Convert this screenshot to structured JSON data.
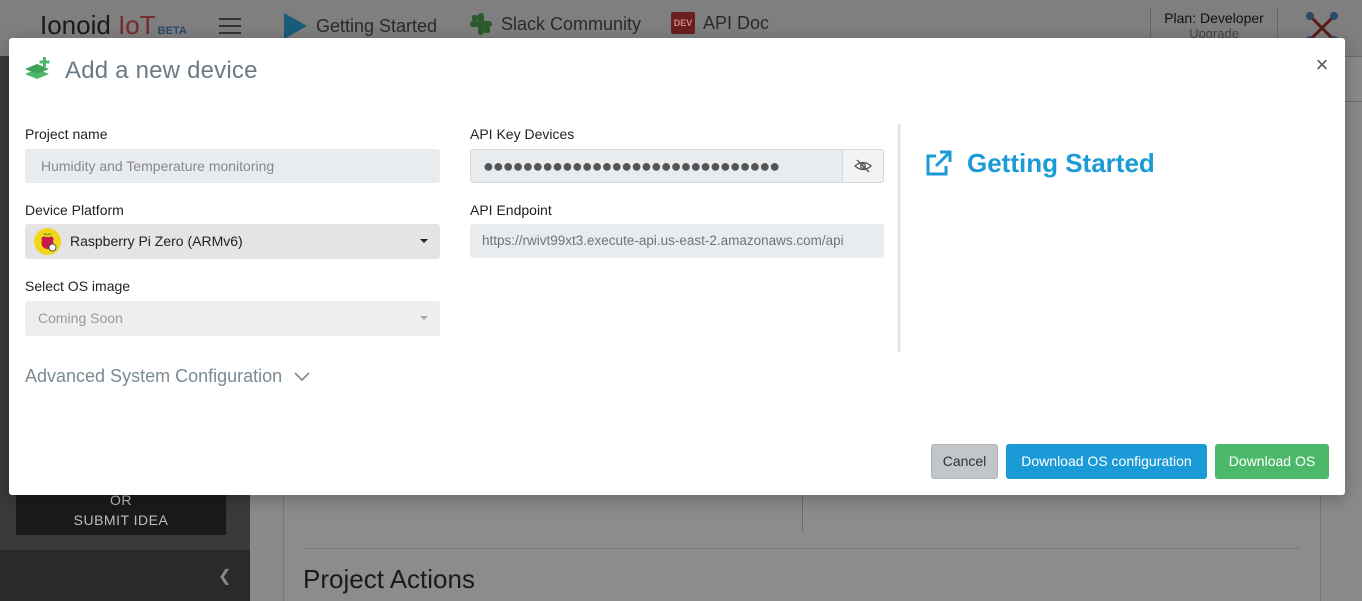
{
  "background": {
    "logo": {
      "main": "Ionoid",
      "iot": "IoT",
      "beta": "BETA"
    },
    "nav": [
      {
        "label": "Getting Started",
        "icon": "play-icon"
      },
      {
        "label": "Slack Community",
        "icon": "slack-icon"
      },
      {
        "label": "API Doc",
        "icon": "dev-icon",
        "badge": "DEV"
      }
    ],
    "plan": {
      "label": "Plan: Developer",
      "sub": "Upgrade"
    },
    "sidebar": {
      "idea_line1": "OR",
      "idea_line2": "SUBMIT IDEA"
    },
    "main": {
      "section_heading": "Project Actions"
    }
  },
  "modal": {
    "title": "Add a new device",
    "close": "×",
    "project_name": {
      "label": "Project name",
      "value": "Humidity and Temperature monitoring"
    },
    "device_platform": {
      "label": "Device Platform",
      "value": "Raspberry Pi Zero (ARMv6)"
    },
    "os_image": {
      "label": "Select OS image",
      "value": "Coming Soon"
    },
    "api_key": {
      "label": "API Key Devices",
      "value": "●●●●●●●●●●●●●●●●●●●●●●●●●●●●●●"
    },
    "api_endpoint": {
      "label": "API Endpoint",
      "value": "https://rwivt99xt3.execute-api.us-east-2.amazonaws.com/api"
    },
    "getting_started": "Getting Started",
    "advanced": "Advanced System Configuration",
    "buttons": {
      "cancel": "Cancel",
      "download_config": "Download OS configuration",
      "download_os": "Download OS"
    }
  },
  "colors": {
    "accent_blue": "#1a9bd7",
    "success_green": "#4cb96a",
    "title_grey": "#6b7b85"
  }
}
